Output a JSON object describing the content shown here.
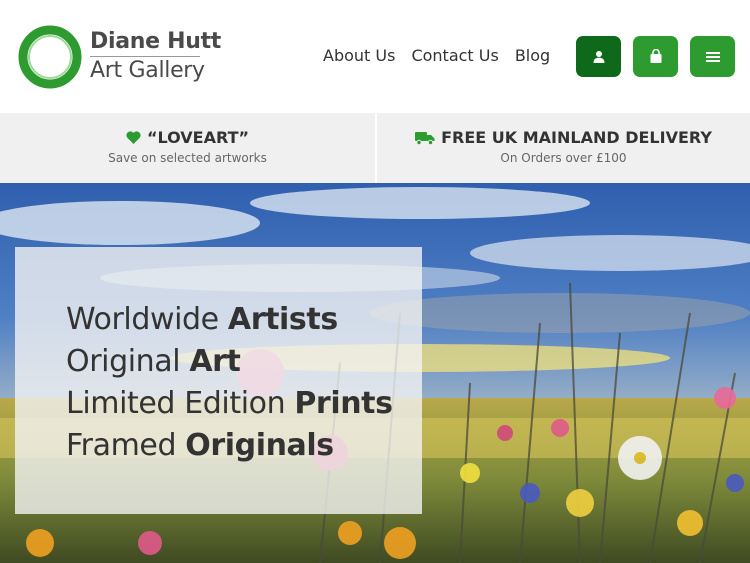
{
  "brand": {
    "name": "Diane Hutt",
    "subtitle": "Art Gallery",
    "logo_icon": "green-ring-logo",
    "colors": {
      "green": "#2e9b30",
      "dark_green": "#0e6a1a"
    }
  },
  "nav": {
    "items": [
      {
        "label": "About Us"
      },
      {
        "label": "Contact Us"
      },
      {
        "label": "Blog"
      }
    ]
  },
  "header_buttons": [
    {
      "icon": "user-icon"
    },
    {
      "icon": "shopping-bag-icon"
    },
    {
      "icon": "menu-icon"
    }
  ],
  "promos": [
    {
      "icon": "heart-icon",
      "title": "“LOVEART”",
      "subtitle": "Save on selected artworks"
    },
    {
      "icon": "truck-icon",
      "title": "FREE UK MAINLAND DELIVERY",
      "subtitle": "On Orders over £100"
    }
  ],
  "hero": {
    "lines": [
      {
        "regular": "Worldwide ",
        "bold": "Artists"
      },
      {
        "regular": "Original ",
        "bold": "Art"
      },
      {
        "regular": "Limited Edition ",
        "bold": "Prints"
      },
      {
        "regular": "Framed ",
        "bold": "Originals"
      }
    ]
  }
}
